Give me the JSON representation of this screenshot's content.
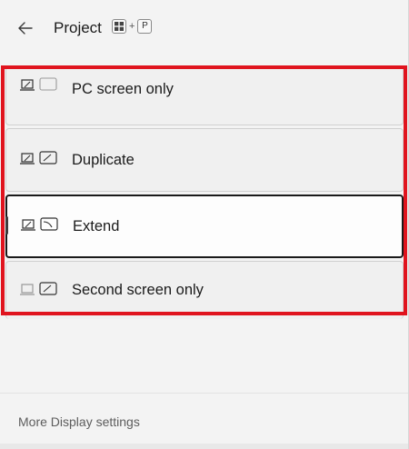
{
  "header": {
    "title": "Project",
    "shortcut_key": "P",
    "shortcut_plus": "+"
  },
  "options": [
    {
      "label": "PC screen only",
      "icon": "pc-screen-only-icon",
      "selected": false
    },
    {
      "label": "Duplicate",
      "icon": "duplicate-icon",
      "selected": false
    },
    {
      "label": "Extend",
      "icon": "extend-icon",
      "selected": true
    },
    {
      "label": "Second screen only",
      "icon": "second-screen-only-icon",
      "selected": false
    }
  ],
  "footer": {
    "link_label": "More Display settings"
  },
  "colors": {
    "highlight": "#e0141e",
    "background": "#f3f3f3",
    "selected_background": "#fdfdfd"
  }
}
